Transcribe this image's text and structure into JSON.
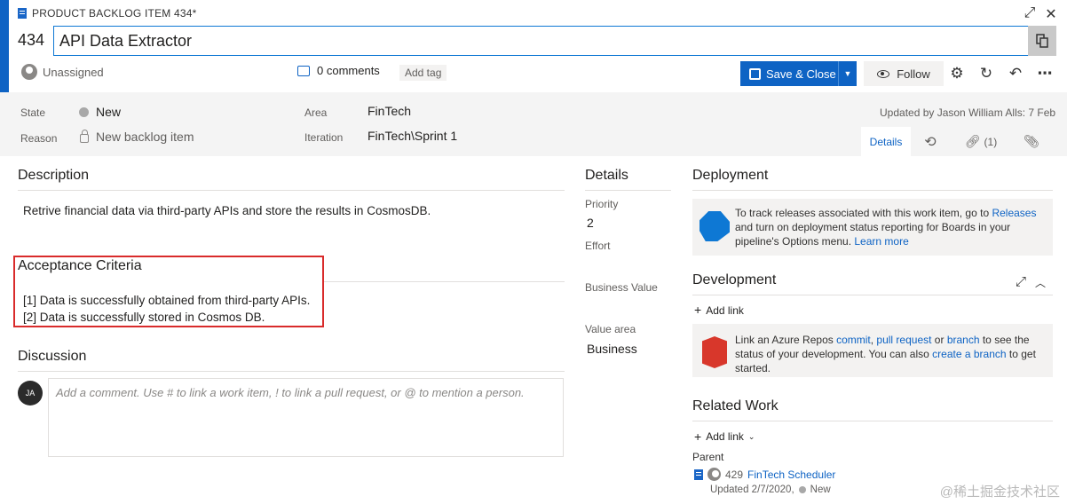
{
  "header": {
    "item_type": "PRODUCT BACKLOG ITEM 434*",
    "id": "434",
    "title_value": "API Data Extractor"
  },
  "toolbar": {
    "assignee": "Unassigned",
    "comments": "0 comments",
    "add_tag": "Add tag",
    "save_close": "Save & Close",
    "follow": "Follow"
  },
  "fields": {
    "state_label": "State",
    "state_value": "New",
    "reason_label": "Reason",
    "reason_value": "New backlog item",
    "area_label": "Area",
    "area_value": "FinTech",
    "iteration_label": "Iteration",
    "iteration_value": "FinTech\\Sprint 1",
    "updated": "Updated by Jason William Alls: 7 Feb"
  },
  "tabs": {
    "details": "Details",
    "links_count": "(1)"
  },
  "description": {
    "heading": "Description",
    "text": "Retrive financial data via third-party APIs and store the results in CosmosDB."
  },
  "acceptance": {
    "heading": "Acceptance Criteria",
    "line1": "[1] Data is successfully obtained from third-party APIs.",
    "line2": "[2] Data is successfully stored in Cosmos DB."
  },
  "discussion": {
    "heading": "Discussion",
    "avatar_initials": "JA",
    "placeholder": "Add a comment. Use # to link a work item, ! to link a pull request, or @ to mention a person."
  },
  "details": {
    "heading": "Details",
    "priority_label": "Priority",
    "priority_value": "2",
    "effort_label": "Effort",
    "business_value_label": "Business Value",
    "value_area_label": "Value area",
    "value_area_value": "Business"
  },
  "deployment": {
    "heading": "Deployment",
    "text_a": "To track releases associated with this work item, go to ",
    "link_releases": "Releases",
    "text_b": " and turn on deployment status reporting for Boards in your pipeline's Options menu. ",
    "link_learn": "Learn more"
  },
  "development": {
    "heading": "Development",
    "add_link": "Add link",
    "text_a": "Link an Azure Repos ",
    "link_commit": "commit",
    "sep1": ", ",
    "link_pr": "pull request",
    "text_or": " or ",
    "link_branch": "branch",
    "text_b": " to see the status of your development. You can also ",
    "link_create": "create a branch",
    "text_c": " to get started."
  },
  "related": {
    "heading": "Related Work",
    "add_link": "Add link",
    "parent_label": "Parent",
    "parent_id": "429",
    "parent_title": "FinTech Scheduler",
    "parent_updated": "Updated 2/7/2020,",
    "parent_state": "New"
  },
  "watermark": "@稀土掘金技术社区"
}
